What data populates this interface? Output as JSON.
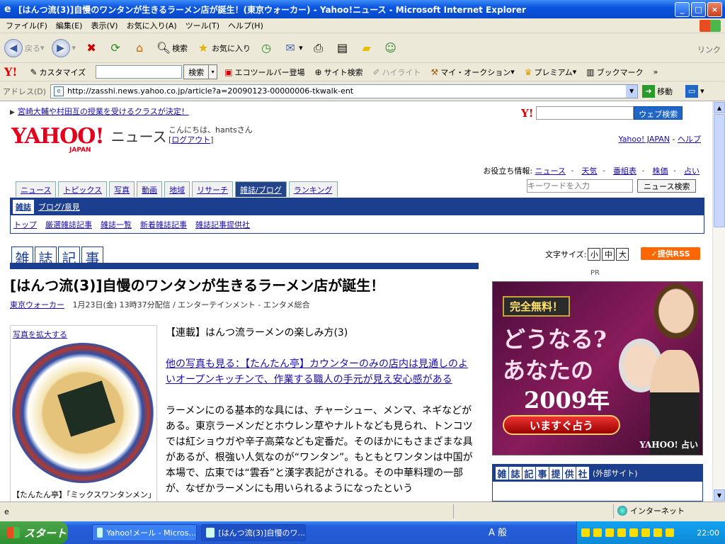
{
  "window": {
    "title": "[はんつ流(3)]自慢のワンタンが生きるラーメン店が誕生！(東京ウォーカー) - Yahoo!ニュース - Microsoft Internet Explorer",
    "min": "_",
    "max": "□",
    "close": "×"
  },
  "menubar": [
    "ファイル(F)",
    "編集(E)",
    "表示(V)",
    "お気に入り(A)",
    "ツール(T)",
    "ヘルプ(H)"
  ],
  "toolbar": {
    "back": "戻る",
    "search": "検索",
    "favorites": "お気に入り",
    "links": "リンク"
  },
  "yahoo_toolbar": {
    "logo": "Y!",
    "customize": "カスタマイズ",
    "search_button": "検索",
    "search_value": "",
    "eco": "エコツールバー登場",
    "site_search": "サイト検索",
    "highlight": "ハイライト",
    "auction": "マイ・オークション",
    "premium": "プレミアム",
    "bookmark": "ブックマーク",
    "more": "»"
  },
  "address": {
    "label": "アドレス(D)",
    "url": "http://zasshi.news.yahoo.co.jp/article?a=20090123-00000006-tkwalk-ent",
    "go": "移動"
  },
  "page": {
    "top_link": "宮崎大輔や村田亙の授業を受けるクラスが決定！",
    "web_search_button": "ウェブ検索",
    "web_search_value": "",
    "logo": "YAHOO!",
    "logo_sub": "JAPAN",
    "section": "ニュース",
    "greeting_line1": "こんにちは、hantsさん",
    "logout": "ログアウト",
    "links_yahoo": "Yahoo! JAPAN",
    "links_help": "ヘルプ",
    "useful_label": "お役立ち情報:",
    "useful": [
      "ニュース",
      "天気",
      "番組表",
      "株価",
      "占い"
    ],
    "tabs": [
      "ニュース",
      "トピックス",
      "写真",
      "動画",
      "地域",
      "リサーチ",
      "雑誌/ブログ",
      "ランキング"
    ],
    "news_search_placeholder": "キーワードを入力",
    "news_search_button": "ニュース検索",
    "subnav1": [
      "雑誌",
      "ブログ/意見"
    ],
    "subnav2": [
      "トップ",
      "厳選雑誌記事",
      "雑誌一覧",
      "新着雑誌記事",
      "雑誌記事提供社"
    ],
    "section_title": [
      "雑",
      "誌",
      "記",
      "事"
    ],
    "font_size_label": "文字サイズ:",
    "font_sizes": [
      "小",
      "中",
      "大"
    ],
    "rss": "提供RSS",
    "pr": "PR",
    "headline": "[はんつ流(3)]自慢のワンタンが生きるラーメン店が誕生！",
    "source": "東京ウォーカー",
    "meta": "1月23日(金) 13時37分配信 / エンターテインメント - エンタメ総合",
    "photo_enlarge": "写真を拡大する",
    "photo_caption": "【たんたん亭】「ミックスワンタンメン」",
    "body_series": "【連載】はんつ流ラーメンの楽しみ方(3)",
    "body_more": "他の写真も見る：【たんたん亭】カウンターのみの店内は見通しのよいオープンキッチンで、作業する職人の手元が見え安心感がある",
    "body_text": "ラーメンにのる基本的な具には、チャーシュー、メンマ、ネギなどがある。東京ラーメンだとホウレン草やナルトなども見られ、トンコツでは紅ショウガや辛子高菜なども定番だ。そのほかにもさまざまな具があるが、根強い人気なのが“ワンタン”。もともとワンタンは中国が本場で、広東では“雲呑”と漢字表記がされる。その中華料理の一部が、なぜかラーメンにも用いられるようになったという",
    "ad_free": "完全無料！",
    "ad_line1": "どうなる?",
    "ad_line2": "あなたの",
    "ad_year": "2009年",
    "ad_cta": "いますぐ占う",
    "ad_brand": "YAHOO! 占い",
    "mag_title": [
      "雑",
      "誌",
      "記",
      "事",
      "提",
      "供",
      "社"
    ],
    "mag_ext": "(外部サイト)"
  },
  "status": {
    "zone": "インターネット"
  },
  "taskbar": {
    "start": "スタート",
    "tasks": [
      "Yahoo!メール - Micros...",
      "[はんつ流(3)]自慢のワ..."
    ],
    "ime": "A 般",
    "clock": "22:00"
  }
}
